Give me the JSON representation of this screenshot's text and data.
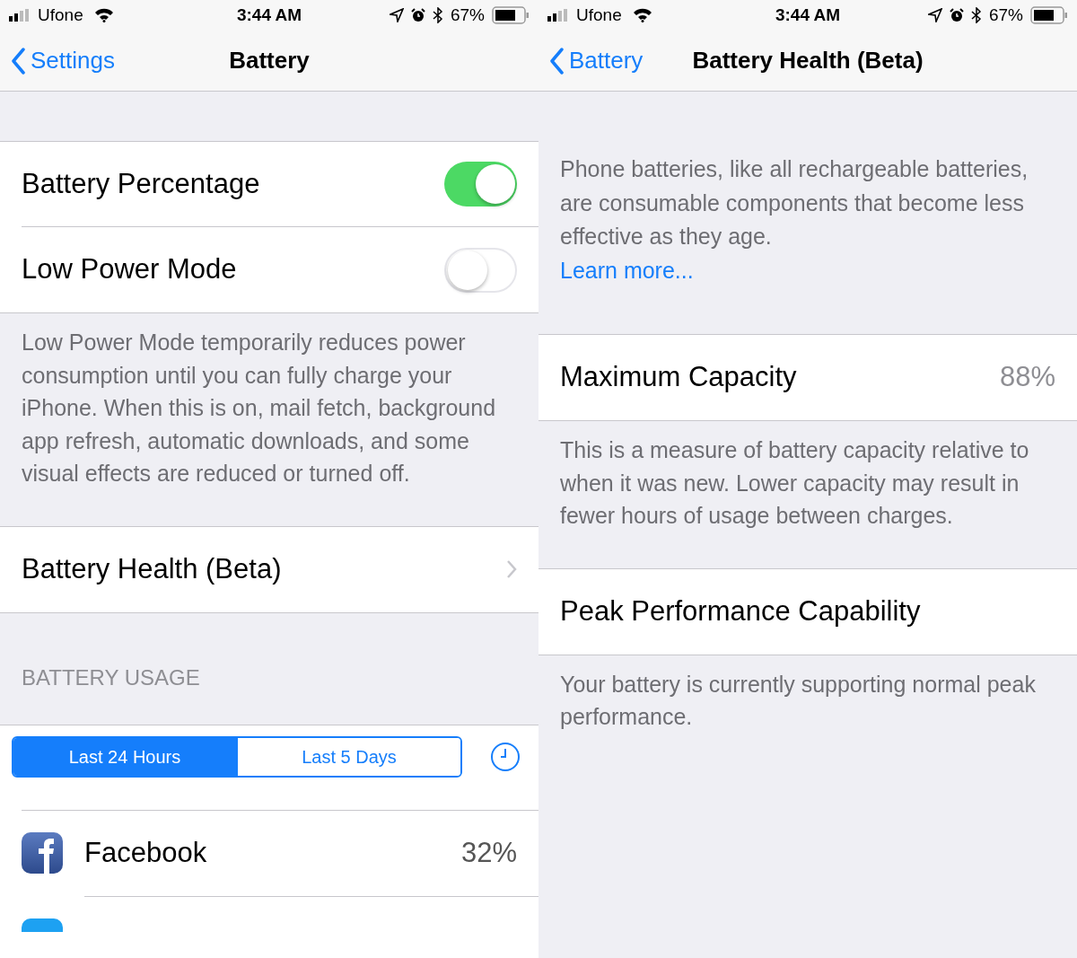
{
  "screens": [
    {
      "status_bar": {
        "carrier": "Ufone",
        "time": "3:44 AM",
        "battery": "67%"
      },
      "nav": {
        "back": "Settings",
        "title": "Battery"
      },
      "blocks": [
        {
          "kind": "group",
          "rows": [
            {
              "kind": "toggle",
              "label": "Battery Percentage",
              "on": true
            },
            {
              "kind": "toggle",
              "label": "Low Power Mode",
              "on": false
            }
          ]
        },
        {
          "kind": "footer",
          "text": "Low Power Mode temporarily reduces power consumption until you can fully charge your iPhone. When this is on, mail fetch, background app refresh, automatic downloads, and some visual effects are reduced or turned off."
        },
        {
          "kind": "group",
          "rows": [
            {
              "kind": "link",
              "label": "Battery Health (Beta)"
            }
          ]
        },
        {
          "kind": "header",
          "text": "BATTERY USAGE"
        },
        {
          "kind": "segmented",
          "segments": [
            {
              "label": "Last 24 Hours",
              "selected": true
            },
            {
              "label": "Last 5 Days",
              "selected": false
            }
          ]
        },
        {
          "kind": "apps",
          "rows": [
            {
              "kind": "app",
              "label": "Facebook",
              "value": "32%"
            },
            {
              "kind": "partial"
            }
          ]
        }
      ]
    },
    {
      "status_bar": {
        "carrier": "Ufone",
        "time": "3:44 AM",
        "battery": "67%"
      },
      "nav": {
        "back": "Battery",
        "title": "Battery Health (Beta)"
      },
      "blocks": [
        {
          "kind": "intro",
          "text": "Phone batteries, like all rechargeable batteries, are consumable components that become less effective as they age.",
          "link": "Learn more..."
        },
        {
          "kind": "group",
          "rows": [
            {
              "kind": "value",
              "label": "Maximum Capacity",
              "value": "88%"
            }
          ]
        },
        {
          "kind": "footer",
          "text": "This is a measure of battery capacity relative to when it was new. Lower capacity may result in fewer hours of usage between charges."
        },
        {
          "kind": "group",
          "rows": [
            {
              "kind": "plain",
              "label": "Peak Performance Capability"
            }
          ]
        },
        {
          "kind": "footer",
          "text": "Your battery is currently supporting normal peak performance."
        }
      ]
    }
  ]
}
